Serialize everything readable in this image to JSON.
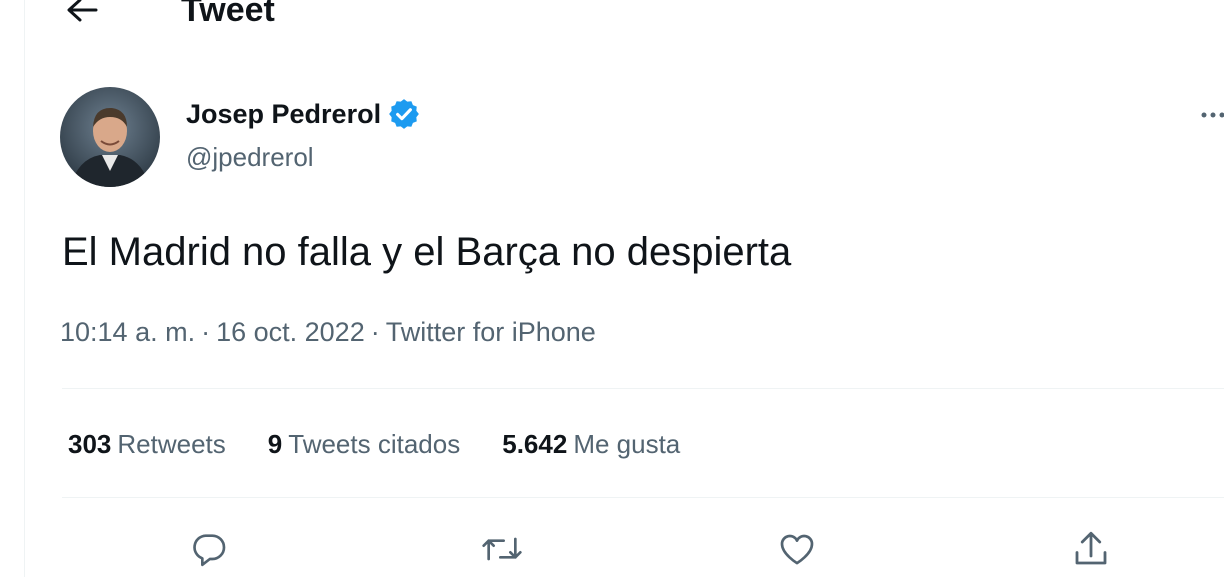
{
  "header": {
    "title": "Tweet",
    "back_icon": "arrow-left-icon"
  },
  "author": {
    "name": "Josep Pedrerol",
    "handle": "@jpedrerol",
    "verified_icon": "verified-badge-icon",
    "verified_color": "#1d9bf0"
  },
  "tweet": {
    "text": "El Madrid no falla y el Barça no despierta",
    "time": "10:14 a. m.",
    "date": "16 oct. 2022",
    "source": "Twitter for iPhone",
    "separator": "·"
  },
  "stats": [
    {
      "count": "303",
      "label": "Retweets"
    },
    {
      "count": "9",
      "label": "Tweets citados"
    },
    {
      "count": "5.642",
      "label": "Me gusta"
    }
  ],
  "actions": [
    {
      "name": "reply",
      "icon": "reply-icon"
    },
    {
      "name": "retweet",
      "icon": "retweet-icon"
    },
    {
      "name": "like",
      "icon": "heart-icon"
    },
    {
      "name": "share",
      "icon": "share-icon"
    }
  ],
  "colors": {
    "text_primary": "#0f1419",
    "text_secondary": "#536471",
    "divider": "#eff3f4",
    "accent": "#1d9bf0"
  }
}
